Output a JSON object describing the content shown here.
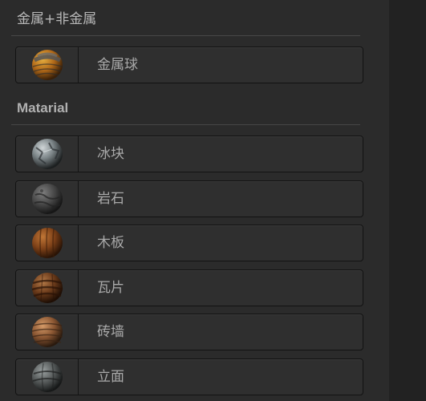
{
  "sections": [
    {
      "title": "金属+非金属",
      "items": [
        {
          "label": "金属球",
          "icon": "metal-sphere-icon",
          "colors": [
            "#3a3a3a",
            "#c87a1e",
            "#e0a030"
          ]
        }
      ]
    },
    {
      "title": "Matarial",
      "items": [
        {
          "label": "冰块",
          "icon": "ice-sphere-icon",
          "colors": [
            "#2e3234",
            "#8e979b",
            "#c4cbce"
          ]
        },
        {
          "label": "岩石",
          "icon": "rock-sphere-icon",
          "colors": [
            "#262626",
            "#5a5a5a",
            "#7a7a7a"
          ]
        },
        {
          "label": "木板",
          "icon": "wood-sphere-icon",
          "colors": [
            "#3a1f0e",
            "#8a4a1c",
            "#b0652a"
          ]
        },
        {
          "label": "瓦片",
          "icon": "tile-sphere-icon",
          "colors": [
            "#2a150a",
            "#7a4420",
            "#a86a3a"
          ]
        },
        {
          "label": "砖墙",
          "icon": "brick-sphere-icon",
          "colors": [
            "#3a2416",
            "#8c5a36",
            "#c08a5c"
          ]
        },
        {
          "label": "立面",
          "icon": "facade-sphere-icon",
          "colors": [
            "#252727",
            "#5f6464",
            "#8c9292"
          ]
        }
      ]
    }
  ]
}
